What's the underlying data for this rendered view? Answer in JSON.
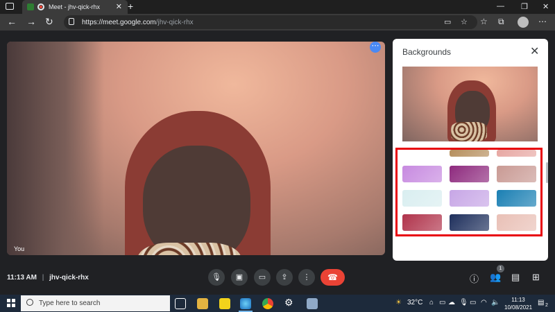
{
  "browser": {
    "tab_title": "Meet - jhv-qick-rhx",
    "url_domain": "https://meet.google.com",
    "url_path": "/jhv-qick-rhx"
  },
  "video": {
    "self_label": "You"
  },
  "backgrounds_panel": {
    "title": "Backgrounds",
    "thumbnail_colors": [
      [
        "#ffffff",
        "#b58e5c",
        "#e7a7a2"
      ],
      [
        "#c78ae0",
        "#8e2a7e",
        "#c99a94"
      ],
      [
        "#d9eef0",
        "#c7a6e6",
        "#1a7fb3"
      ],
      [
        "#b0334b",
        "#1e2f5c",
        "#e9c0b6"
      ]
    ],
    "highlight_color": "#e8000b"
  },
  "bottom_bar": {
    "time": "11:13 AM",
    "separator": "|",
    "meeting_code": "jhv-qick-rhx",
    "participants_count": "1"
  },
  "taskbar": {
    "search_placeholder": "Type here to search",
    "weather": "32°C",
    "clock_time": "11:13",
    "clock_date": "10/08/2021",
    "notifications_count": "2"
  }
}
